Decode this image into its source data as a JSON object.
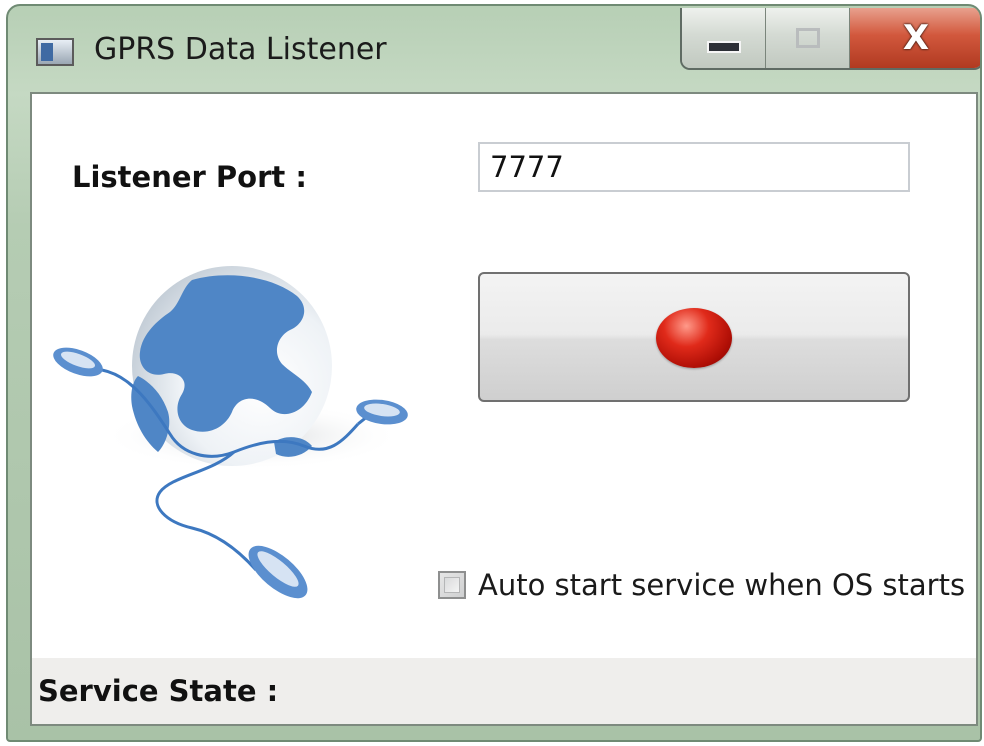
{
  "window": {
    "title": "GPRS Data Listener"
  },
  "titlebar": {
    "icon": "app-window-icon",
    "close_glyph": "X"
  },
  "form": {
    "port_label": "Listener Port :",
    "port_value": "7777",
    "start_button_icon": "record-icon",
    "autostart_label": "Auto start service when OS starts",
    "autostart_checked": false
  },
  "status": {
    "state_label": "Service State :"
  },
  "illustration": {
    "name": "globe-with-mice",
    "colors": {
      "globe_blue": "#4f86c6",
      "cable": "#3d78c0"
    }
  }
}
